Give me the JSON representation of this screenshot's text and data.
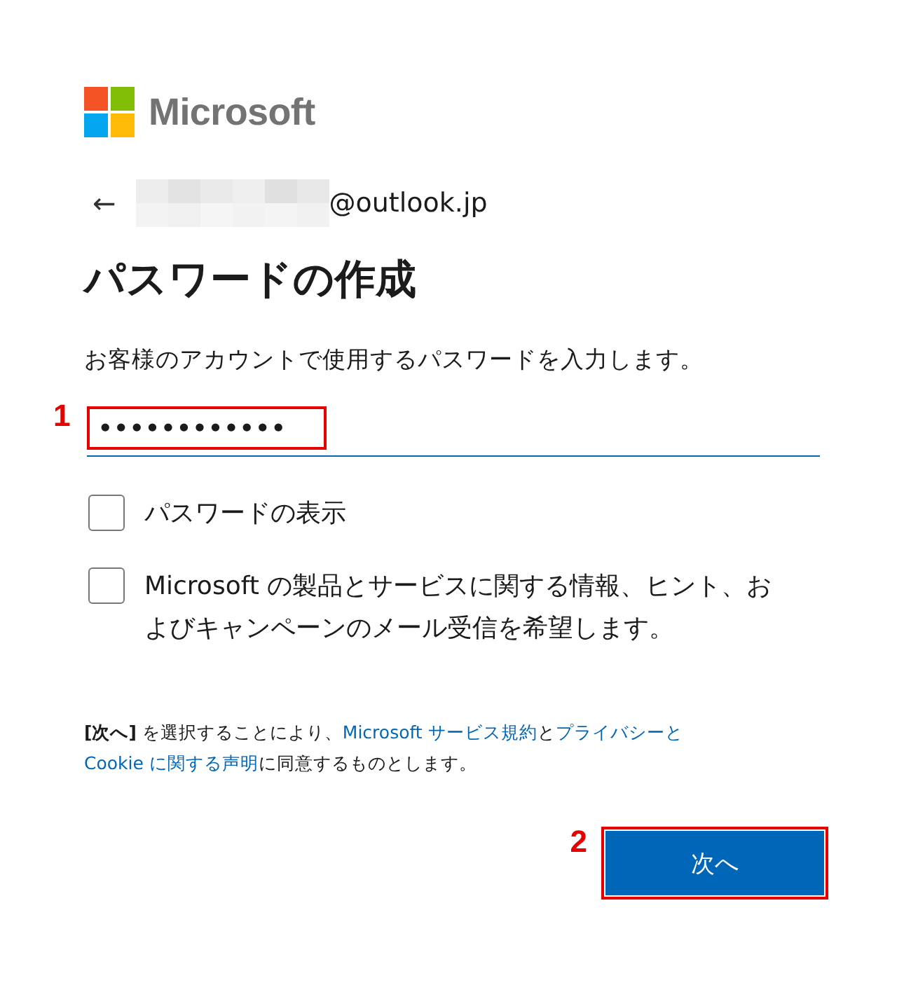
{
  "brand": {
    "name": "Microsoft"
  },
  "account": {
    "back_icon": "←",
    "email_suffix": "@outlook.jp"
  },
  "title": "パスワードの作成",
  "description": "お客様のアカウントで使用するパスワードを入力します。",
  "password_field": {
    "value": "••••••••••••",
    "annotation": "1"
  },
  "options": [
    {
      "label": "パスワードの表示",
      "checked": false
    },
    {
      "label": "Microsoft の製品とサービスに関する情報、ヒント、およびキャンペーンのメール受信を希望します。",
      "checked": false
    }
  ],
  "consent": [
    {
      "kind": "text",
      "text": "**[次へ]** を選択することにより、"
    },
    {
      "kind": "link",
      "text": "Microsoft サービス規約"
    },
    {
      "kind": "text",
      "text": "と"
    },
    {
      "kind": "link",
      "text": "プライバシーと"
    },
    {
      "kind": "link",
      "text": "Cookie に関する声明"
    },
    {
      "kind": "text",
      "text": "に同意するものとします。"
    }
  ],
  "next_button": {
    "label": "次へ",
    "annotation": "2"
  }
}
